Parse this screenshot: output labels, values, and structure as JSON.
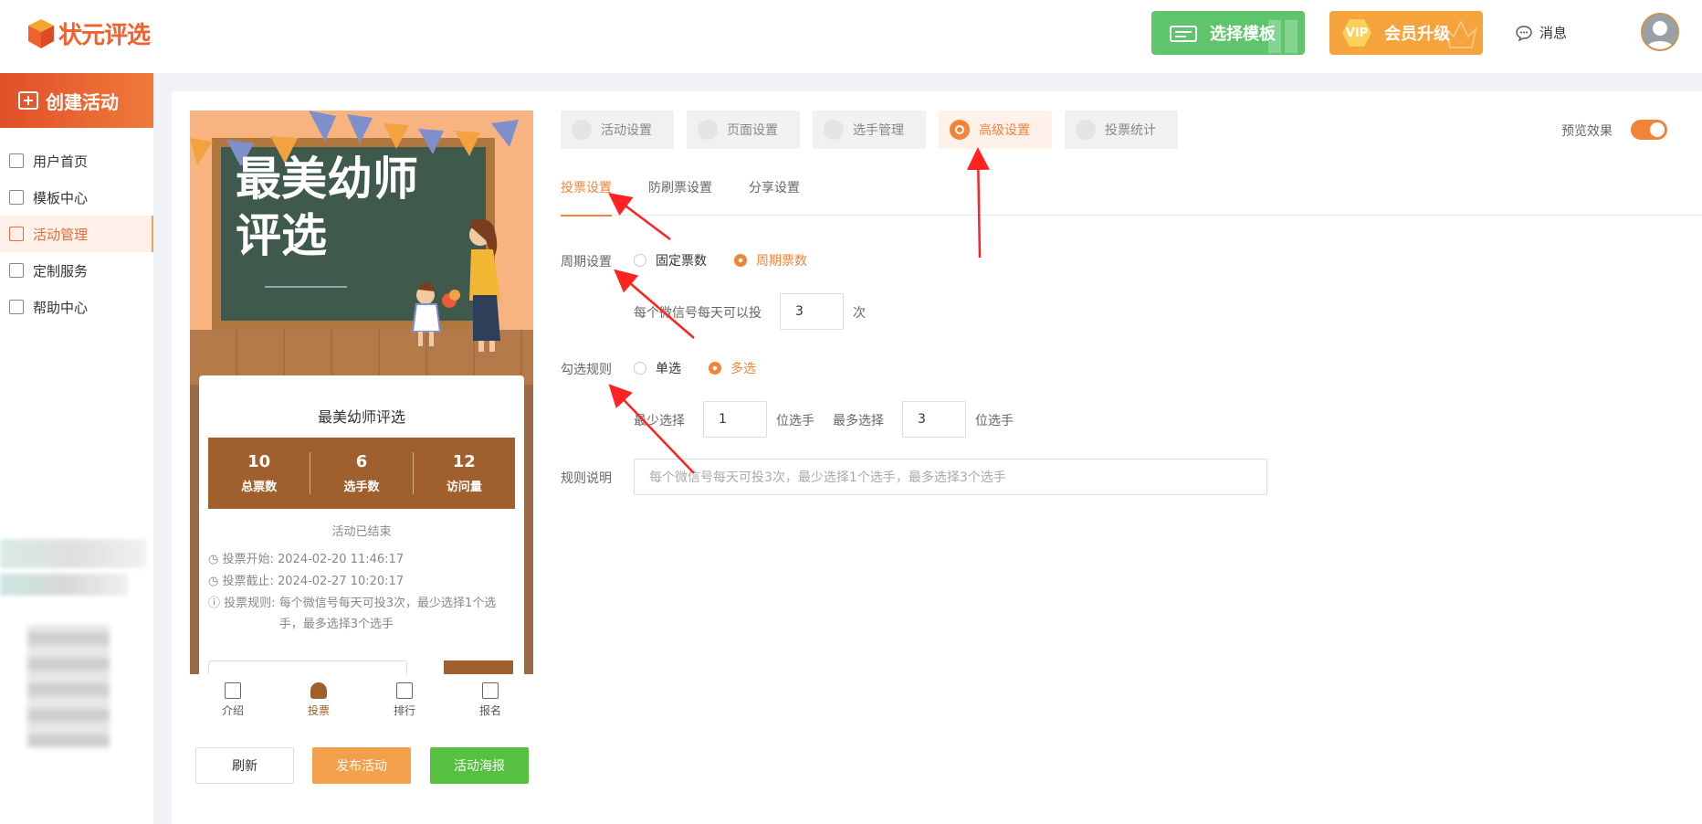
{
  "header": {
    "logo_text": "状元评选",
    "template_button": "选择模板",
    "vip_badge": "VIP",
    "vip_button": "会员升级",
    "messages": "消息"
  },
  "sidebar": {
    "create": "创建活动",
    "items": [
      {
        "label": "用户首页",
        "icon": "home-icon"
      },
      {
        "label": "模板中心",
        "icon": "template-icon"
      },
      {
        "label": "活动管理",
        "icon": "ticket-icon"
      },
      {
        "label": "定制服务",
        "icon": "custom-icon"
      },
      {
        "label": "帮助中心",
        "icon": "help-icon"
      }
    ]
  },
  "preview_phone": {
    "banner_title_line1": "最美幼师",
    "banner_title_line2": "评选",
    "card_title": "最美幼师评选",
    "stats": [
      {
        "value": "10",
        "label": "总票数"
      },
      {
        "value": "6",
        "label": "选手数"
      },
      {
        "value": "12",
        "label": "访问量"
      }
    ],
    "status": "活动已结束",
    "start_label": "投票开始:",
    "start_value": "2024-02-20 11:46:17",
    "end_label": "投票截止:",
    "end_value": "2024-02-27 10:20:17",
    "rule_label": "投票规则:",
    "rule_value": "每个微信号每天可投3次，最少选择1个选手，最多选择3个选手",
    "bottom_tabs": [
      "介绍",
      "投票",
      "排行",
      "报名"
    ],
    "active_tab": "投票"
  },
  "actions": {
    "refresh": "刷新",
    "publish": "发布活动",
    "poster": "活动海报"
  },
  "tabs": [
    {
      "label": "活动设置",
      "active": false
    },
    {
      "label": "页面设置",
      "active": false
    },
    {
      "label": "选手管理",
      "active": false
    },
    {
      "label": "高级设置",
      "active": true
    },
    {
      "label": "投票统计",
      "active": false
    }
  ],
  "preview_toggle": {
    "label": "预览效果",
    "on": true
  },
  "subtabs": [
    "投票设置",
    "防刷票设置",
    "分享设置"
  ],
  "form": {
    "cycle_label": "周期设置",
    "cycle_options": [
      "固定票数",
      "周期票数"
    ],
    "cycle_selected": "周期票数",
    "per_day_label": "每个微信号每天可以投",
    "per_day_value": "3",
    "per_day_unit": "次",
    "select_label": "勾选规则",
    "select_options": [
      "单选",
      "多选"
    ],
    "select_selected": "多选",
    "min_label": "最少选择",
    "min_value": "1",
    "min_unit": "位选手",
    "max_label": "最多选择",
    "max_value": "3",
    "max_unit": "位选手",
    "rule_label": "规则说明",
    "rule_placeholder": "每个微信号每天可投3次，最少选择1个选手，最多选择3个选手"
  },
  "colors": {
    "accent": "#f0853a",
    "brand": "#f0612e",
    "green": "#56c040",
    "brown": "#a0602e"
  }
}
